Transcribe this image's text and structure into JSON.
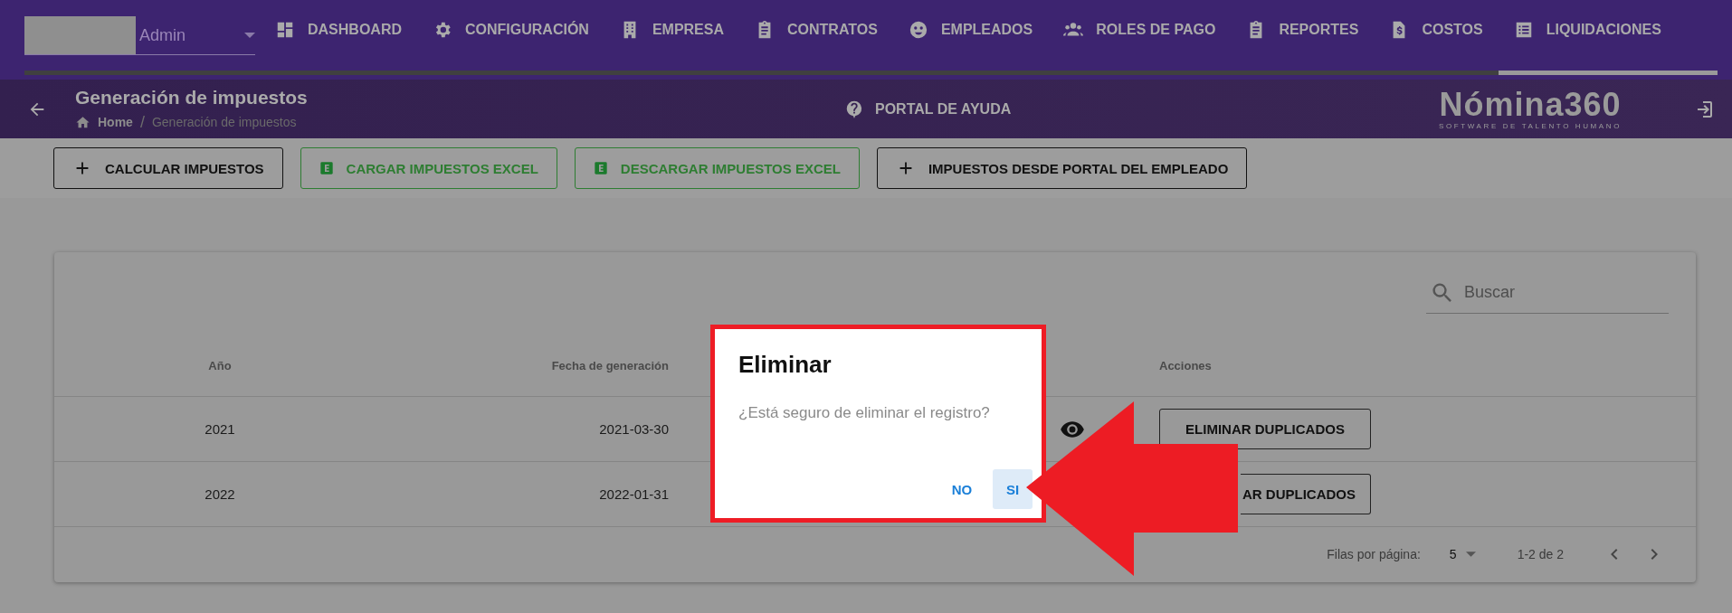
{
  "user_select": {
    "value": "Admin"
  },
  "nav": [
    {
      "label": "DASHBOARD",
      "selected": false
    },
    {
      "label": "CONFIGURACIÓN",
      "selected": false
    },
    {
      "label": "EMPRESA",
      "selected": false
    },
    {
      "label": "CONTRATOS",
      "selected": false
    },
    {
      "label": "EMPLEADOS",
      "selected": false
    },
    {
      "label": "ROLES DE PAGO",
      "selected": false
    },
    {
      "label": "REPORTES",
      "selected": false
    },
    {
      "label": "COSTOS",
      "selected": false
    },
    {
      "label": "LIQUIDACIONES",
      "selected": true
    }
  ],
  "header": {
    "title": "Generación de impuestos",
    "breadcrumb": [
      "Home",
      "Generación de impuestos"
    ],
    "breadcrumb_separator": "/",
    "help_link": "PORTAL DE AYUDA",
    "logo": {
      "name": "Nómina360",
      "tagline": "SOFTWARE DE TALENTO HUMANO"
    }
  },
  "toolbar": [
    {
      "label": "CALCULAR IMPUESTOS",
      "kind": "add"
    },
    {
      "label": "CARGAR IMPUESTOS EXCEL",
      "kind": "excel"
    },
    {
      "label": "DESCARGAR IMPUESTOS EXCEL",
      "kind": "excel"
    },
    {
      "label": "IMPUESTOS DESDE PORTAL DEL EMPLEADO",
      "kind": "add"
    }
  ],
  "table": {
    "search": {
      "placeholder": "Buscar"
    },
    "columns": [
      "Año",
      "Fecha de generación",
      "Acciones"
    ],
    "rows": [
      {
        "year": "2021",
        "date": "2021-03-30",
        "covered": false,
        "action": "ELIMINAR DUPLICADOS"
      },
      {
        "year": "2022",
        "date": "2022-01-31",
        "covered": true,
        "action": "AR DUPLICADOS"
      }
    ],
    "footer": {
      "rows_per_page_label": "Filas por página:",
      "rows_per_page": "5",
      "range": "1-2 de 2"
    }
  },
  "dialog": {
    "title": "Eliminar",
    "message": "¿Está seguro de eliminar el registro?",
    "buttons": [
      {
        "label": "NO",
        "focused": false
      },
      {
        "label": "SI",
        "focused": true
      }
    ]
  },
  "annotation": {
    "kind": "arrow"
  }
}
